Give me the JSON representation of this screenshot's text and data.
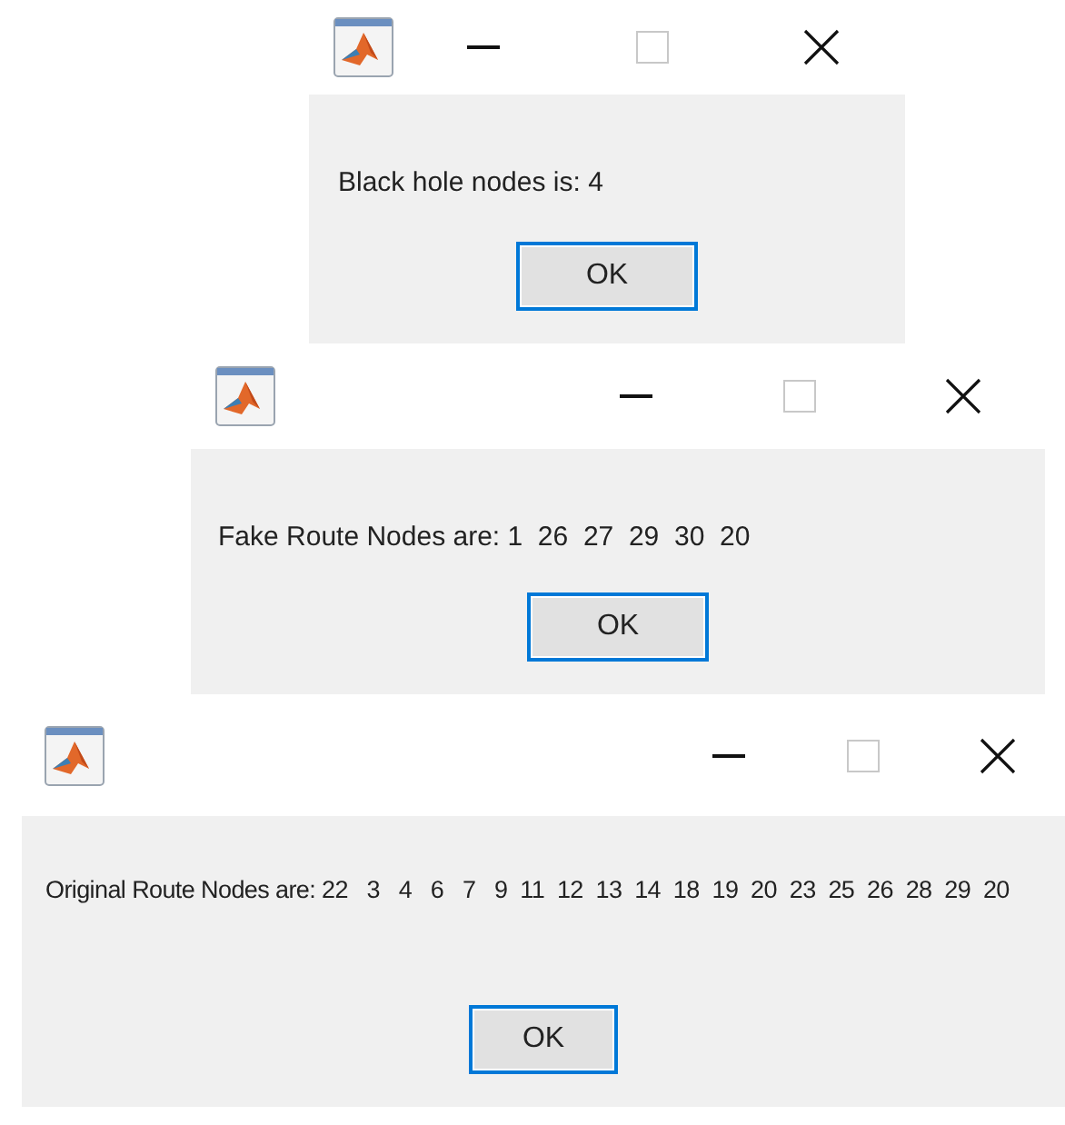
{
  "dialogs": [
    {
      "message": "Black hole nodes is: 4",
      "button": "OK"
    },
    {
      "message": "Fake Route Nodes are: 1  26  27  29  30  20",
      "button": "OK"
    },
    {
      "message": "Original Route Nodes are: 22   3   4   6   7   9  11  12  13  14  18  19  20  23  25  26  28  29  20",
      "button": "OK"
    }
  ]
}
